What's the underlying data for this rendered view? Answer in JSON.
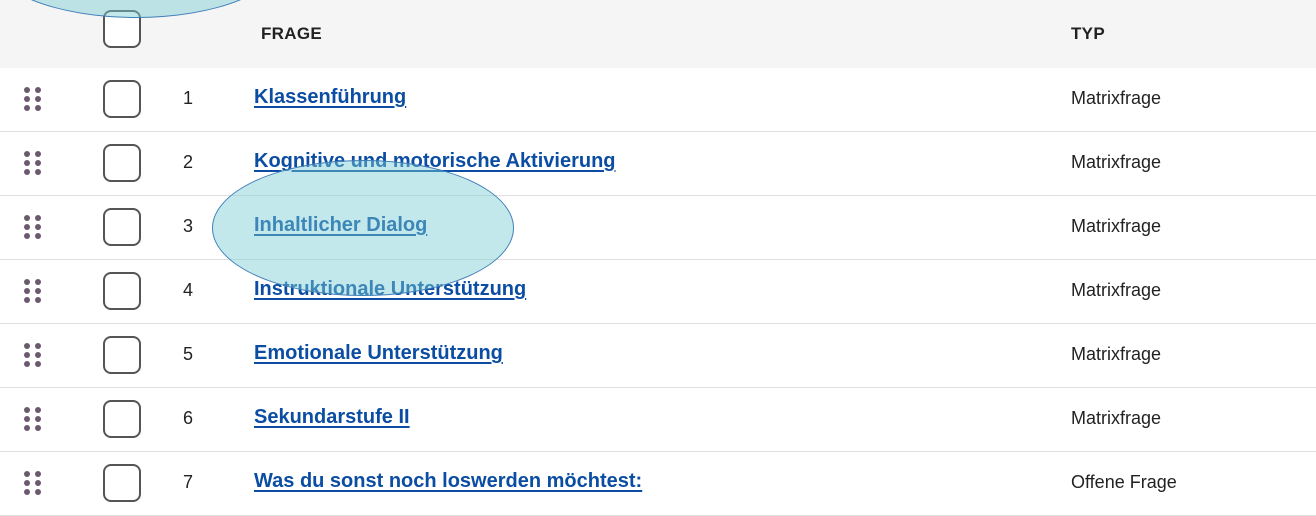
{
  "table": {
    "columns": {
      "frage": "FRAGE",
      "typ": "TYP"
    },
    "rows": [
      {
        "number": "1",
        "title": "Klassenführung",
        "type": "Matrixfrage"
      },
      {
        "number": "2",
        "title": "Kognitive und motorische Aktivierung",
        "type": "Matrixfrage"
      },
      {
        "number": "3",
        "title": "Inhaltlicher Dialog",
        "type": "Matrixfrage"
      },
      {
        "number": "4",
        "title": "Instruktionale Unterstützung",
        "type": "Matrixfrage"
      },
      {
        "number": "5",
        "title": "Emotionale Unterstützung",
        "type": "Matrixfrage"
      },
      {
        "number": "6",
        "title": "Sekundarstufe II",
        "type": "Matrixfrage"
      },
      {
        "number": "7",
        "title": "Was du sonst noch loswerden möchtest:",
        "type": "Offene Frage"
      }
    ]
  },
  "icons": {
    "drag_handle": "drag-handle-icon",
    "checkbox": "checkbox-unchecked"
  },
  "colors": {
    "link": "#0b4da2",
    "header_bg": "#f5f5f5",
    "highlight_fill": "#78cdd2"
  }
}
